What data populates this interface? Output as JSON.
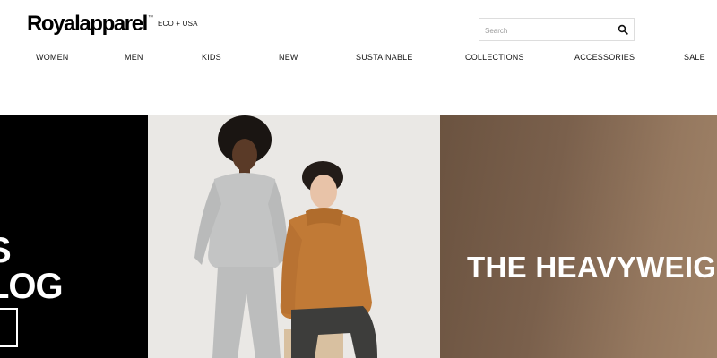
{
  "header": {
    "logo": {
      "text": "Royalapparel",
      "tm": "™",
      "tagline": "ECO + USA"
    },
    "search": {
      "placeholder": "Search"
    },
    "nav": [
      {
        "label": "WOMEN"
      },
      {
        "label": "MEN"
      },
      {
        "label": "KIDS"
      },
      {
        "label": "NEW"
      },
      {
        "label": "SUSTAINABLE"
      },
      {
        "label": "COLLECTIONS"
      },
      {
        "label": "ACCESSORIES"
      },
      {
        "label": "SALE"
      }
    ]
  },
  "hero": {
    "slide_left": {
      "line1": "S",
      "line2": "LOG"
    },
    "slide_right": {
      "title": "THE HEAVYWEIG"
    }
  },
  "colors": {
    "brand": "#000000",
    "hero_brown": "#7a604c"
  }
}
